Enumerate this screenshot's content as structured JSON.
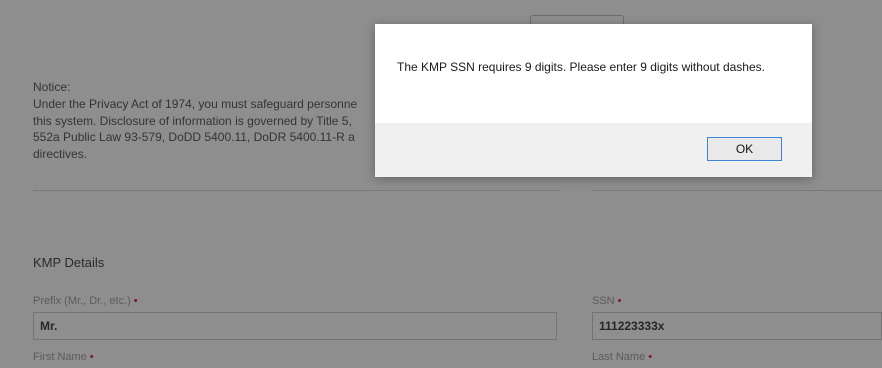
{
  "form": {
    "notice_title": "Notice:",
    "notice_text": "Under the Privacy Act of 1974, you must safeguard personne\nthis system. Disclosure of information is governed by Title 5,\n552a Public Law 93-579, DoDD 5400.11, DoDR 5400.11-R a\ndirectives.",
    "section_title": "KMP Details",
    "prefix_label": "Prefix (Mr., Dr., etc.)",
    "prefix_value": "Mr.",
    "ssn_label": "SSN",
    "ssn_value": "111223333x",
    "first_name_label": "First Name",
    "last_name_label": "Last Name",
    "required_marker": "•"
  },
  "dialog": {
    "message": "The KMP SSN requires 9 digits. Please enter 9 digits without dashes.",
    "ok_label": "OK"
  },
  "colors": {
    "overlay": "rgba(0,0,0,0.42)",
    "ok_border": "#3b86d8",
    "required": "#d7263d"
  }
}
